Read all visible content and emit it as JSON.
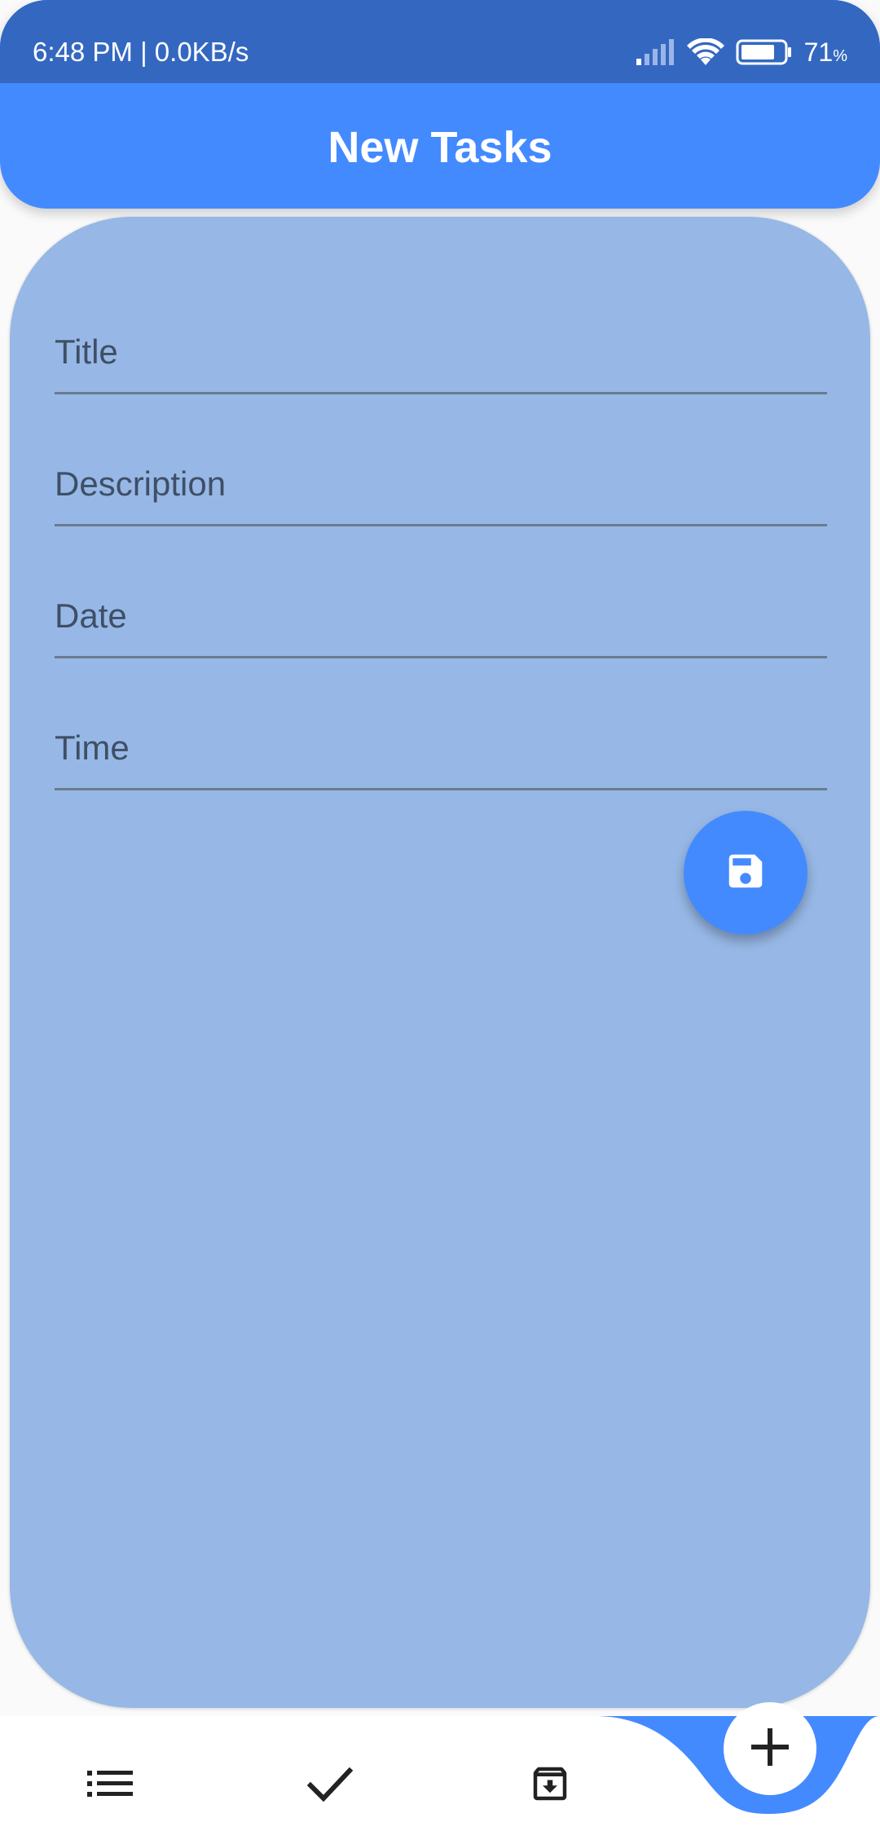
{
  "status_bar": {
    "time_speed": "6:48 PM | 0.0KB/s",
    "battery_level": "71",
    "battery_unit": "%",
    "icons": [
      "signal-icon",
      "wifi-icon",
      "battery-icon"
    ]
  },
  "app_bar": {
    "title": "New Tasks"
  },
  "form": {
    "fields": [
      {
        "label": "Title",
        "value": ""
      },
      {
        "label": "Description",
        "value": ""
      },
      {
        "label": "Date",
        "value": ""
      },
      {
        "label": "Time",
        "value": ""
      }
    ],
    "save_icon": "save-icon"
  },
  "bottom_nav": {
    "items": [
      {
        "icon": "list-icon",
        "selected": false
      },
      {
        "icon": "check-icon",
        "selected": false
      },
      {
        "icon": "archive-icon",
        "selected": false
      },
      {
        "icon": "add-icon",
        "selected": true
      }
    ]
  },
  "colors": {
    "primary": "#448aff",
    "status_bar": "#3468c0",
    "card": "#97b8e6",
    "label": "#3e4f66"
  }
}
